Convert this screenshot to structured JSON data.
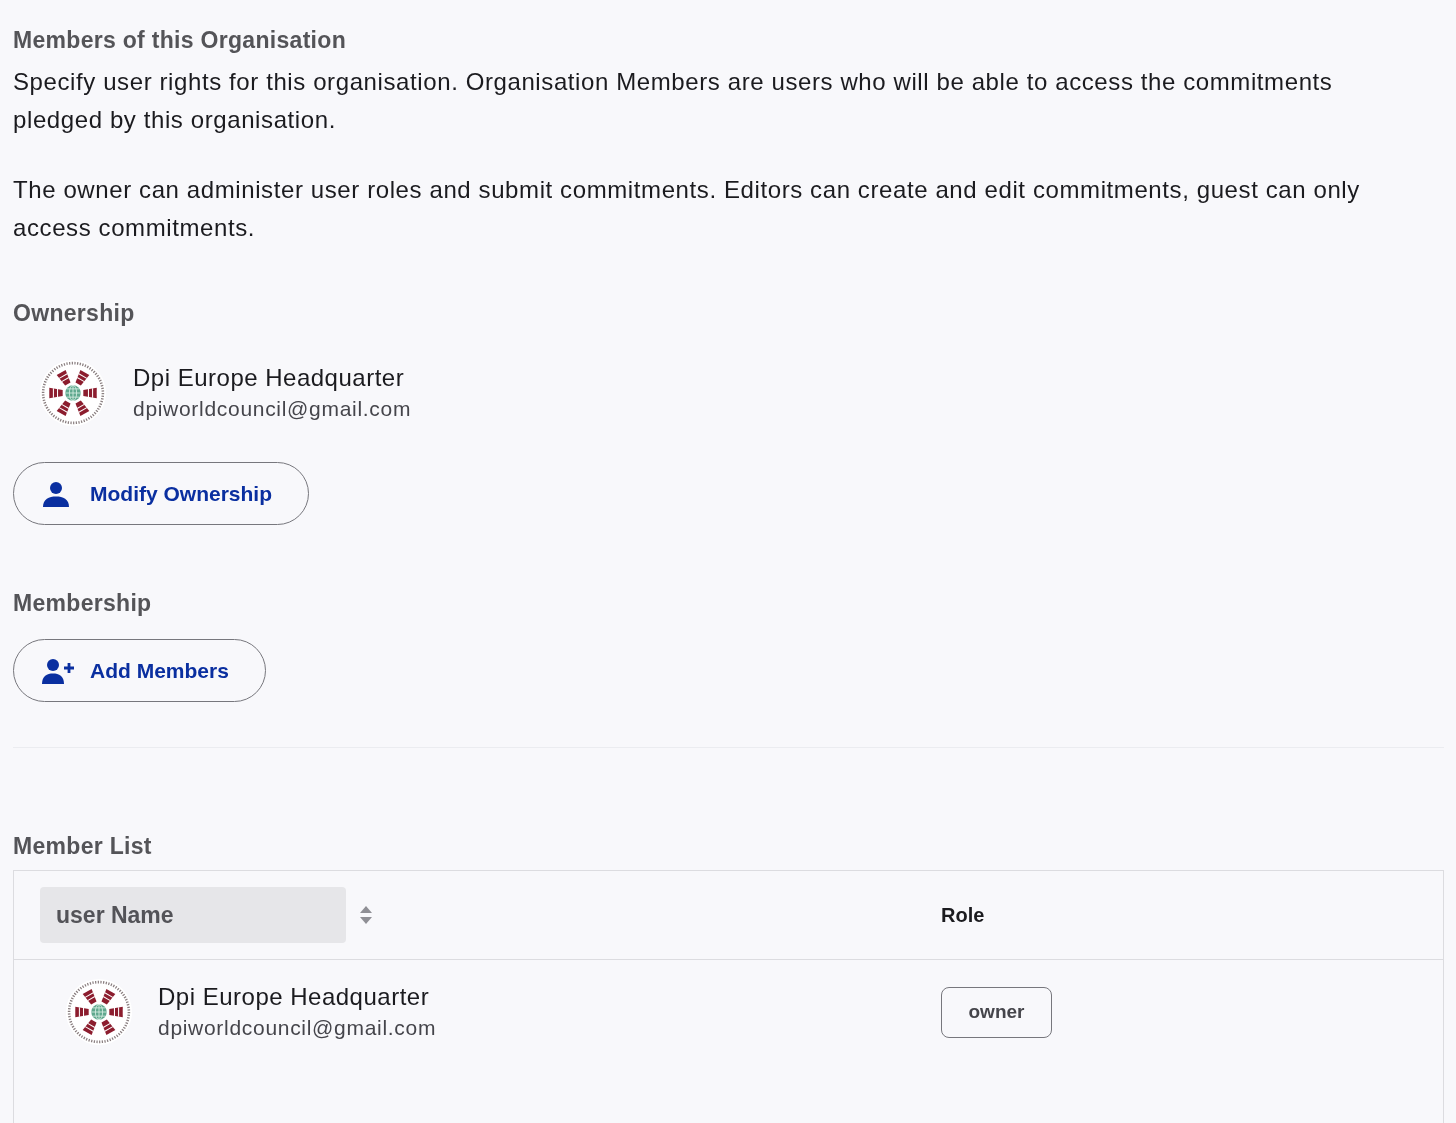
{
  "heading": "Members of this Organisation",
  "description": [
    "Specify user rights for this organisation. Organisation Members are users who will be able to access the commitments pledged by this organisation.",
    "The owner can administer user roles and submit commitments. Editors can create and edit commitments, guest can only access commitments."
  ],
  "ownership": {
    "title": "Ownership",
    "owner": {
      "name": "Dpi Europe Headquarter",
      "email": "dpiworldcouncil@gmail.com"
    },
    "button": {
      "label": "Modify Ownership",
      "kind": "person"
    }
  },
  "membership": {
    "title": "Membership",
    "button": {
      "label": "Add Members",
      "kind": "person-add"
    }
  },
  "member_list": {
    "title": "Member List",
    "columns": [
      {
        "label": "user Name",
        "sortable": true
      },
      {
        "label": "Role",
        "sortable": false
      }
    ],
    "rows": [
      {
        "name": "Dpi Europe Headquarter",
        "email": "dpiworldcouncil@gmail.com",
        "role": "owner"
      }
    ]
  }
}
